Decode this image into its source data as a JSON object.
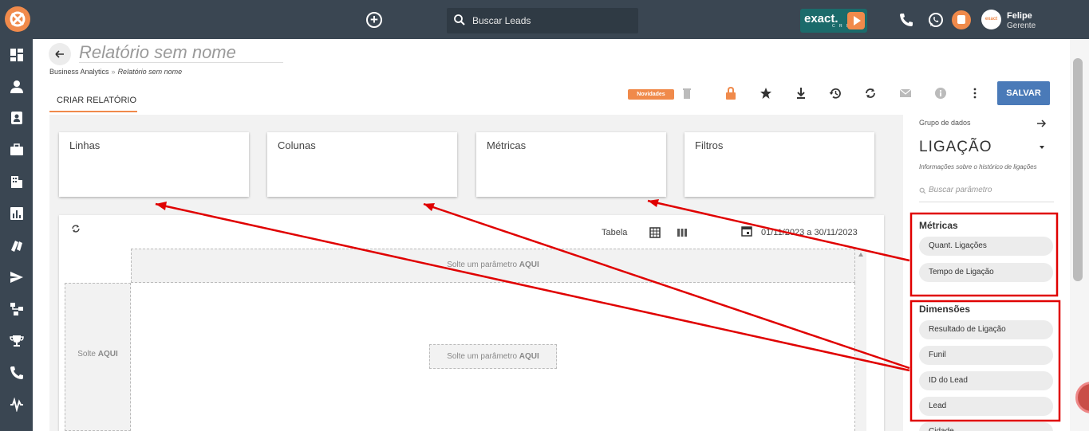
{
  "header": {
    "search_placeholder": "Buscar Leads",
    "brand_text": "exact.",
    "brand_sub": "C R M",
    "avatar_text": "exact",
    "user_name": "Felipe",
    "user_role": "Gerente"
  },
  "sidebar": {
    "items": [
      "dashboard-icon",
      "person-icon",
      "contact-card-icon",
      "briefcase-icon",
      "building-icon",
      "bar-chart-icon",
      "cards-icon",
      "send-icon",
      "flow-icon",
      "trophy-icon",
      "phone-icon",
      "pulse-icon"
    ]
  },
  "page": {
    "title": "Relatório sem nome",
    "breadcrumb_root": "Business Analytics",
    "breadcrumb_sep": "»",
    "breadcrumb_current": "Relatório sem nome",
    "tab_label": "CRIAR RELATÓRIO",
    "novidades_label": "Novidades",
    "save_label": "SALVAR"
  },
  "drop_zones": {
    "linhas": "Linhas",
    "colunas": "Colunas",
    "metricas": "Métricas",
    "filtros": "Filtros"
  },
  "grid": {
    "view_label": "Tabela",
    "date_range": "01/11/2023 a 30/11/2023",
    "drop_cols_prefix": "Solte um parâmetro ",
    "drop_cols_bold": "AQUI",
    "drop_rows_prefix": "Solte ",
    "drop_rows_bold": "AQUI",
    "drop_center_prefix": "Solte um parâmetro ",
    "drop_center_bold": "AQUI"
  },
  "right_panel": {
    "grupo_label": "Grupo de dados",
    "grupo_value": "LIGAÇÃO",
    "grupo_desc": "Informações sobre o histórico de ligações",
    "param_placeholder": "Buscar parâmetro",
    "metricas_title": "Métricas",
    "metricas": [
      "Quant. Ligações",
      "Tempo de Ligação"
    ],
    "dimensoes_title": "Dimensões",
    "dimensoes": [
      "Resultado de Ligação",
      "Funil",
      "ID do Lead",
      "Lead"
    ],
    "next_partial": "Cidade"
  },
  "colors": {
    "topbar": "#3a4652",
    "accent": "#f08a4b",
    "save": "#4a7ab8",
    "annotation": "#e00000"
  }
}
